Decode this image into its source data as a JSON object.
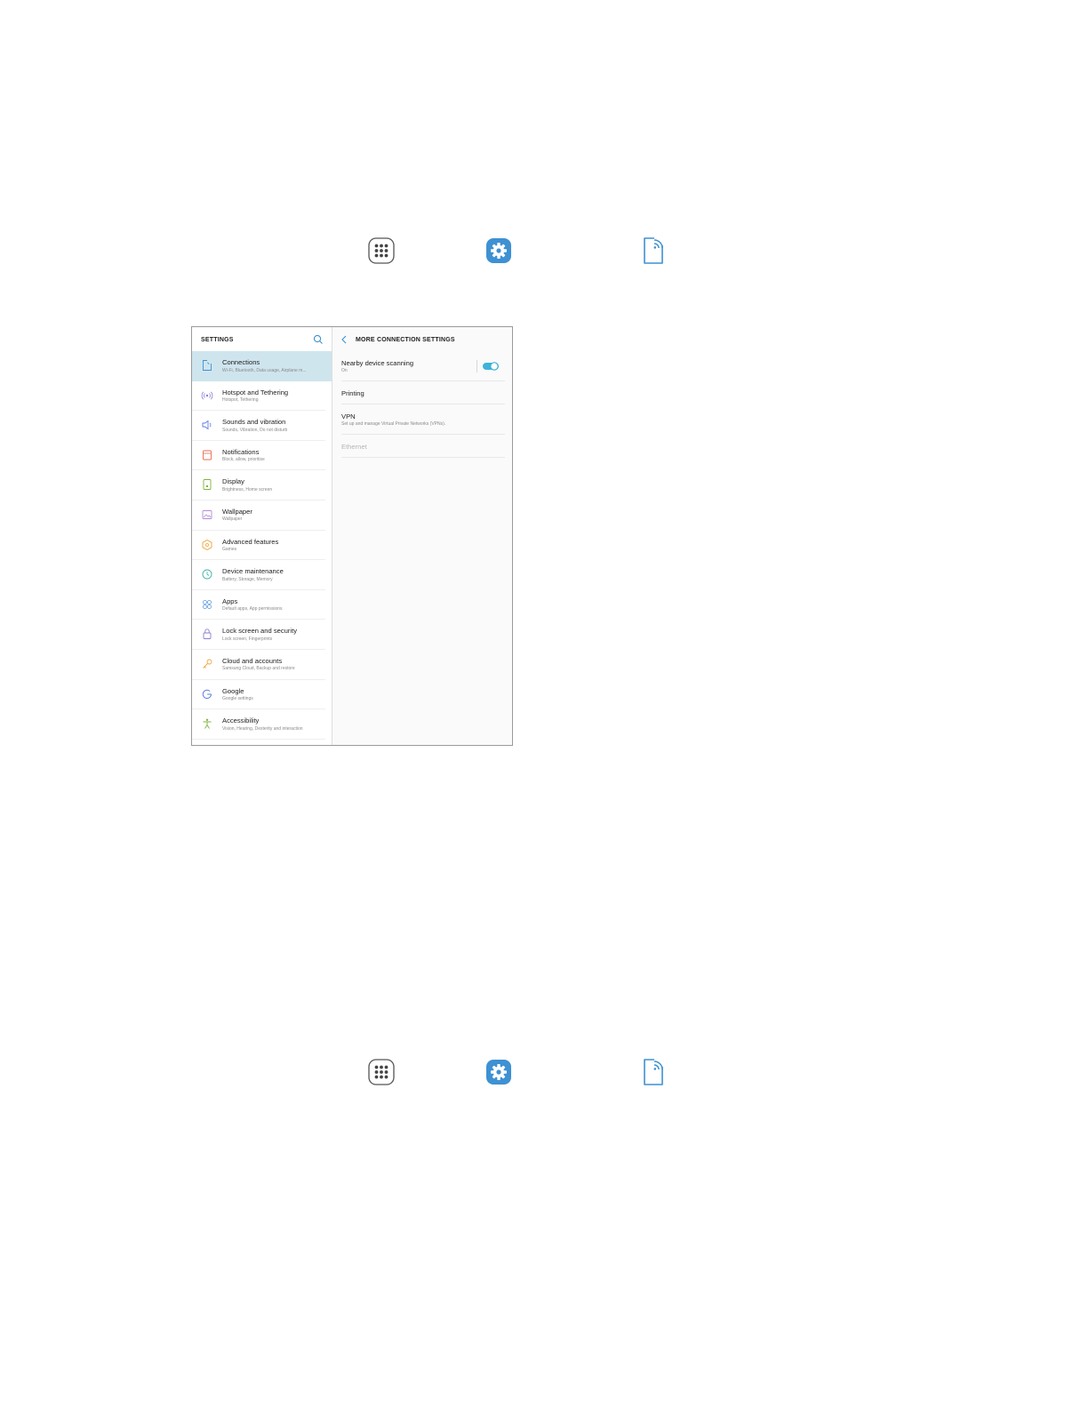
{
  "icons": {
    "apps_icon": "apps-grid-icon",
    "settings_icon": "settings-gear-icon",
    "connections_icon": "connections-icon"
  },
  "colors": {
    "accent": "#3e91d2",
    "selected_bg": "#cfe5ee",
    "toggle_on": "#3fb3d8"
  },
  "settings": {
    "header": "SETTINGS",
    "items": [
      {
        "title": "Connections",
        "subtitle": "Wi-Fi, Bluetooth, Data usage, Airplane m...",
        "icon": "connections-icon",
        "color": "#3e91d2",
        "selected": true
      },
      {
        "title": "Hotspot and Tethering",
        "subtitle": "Hotspot, Tethering",
        "icon": "hotspot-icon",
        "color": "#8e7bd8"
      },
      {
        "title": "Sounds and vibration",
        "subtitle": "Sounds, Vibration, Do not disturb",
        "icon": "sound-icon",
        "color": "#5b7ee0"
      },
      {
        "title": "Notifications",
        "subtitle": "Block, allow, prioritise",
        "icon": "notification-icon",
        "color": "#e86b50"
      },
      {
        "title": "Display",
        "subtitle": "Brightness, Home screen",
        "icon": "display-icon",
        "color": "#7fb33b"
      },
      {
        "title": "Wallpaper",
        "subtitle": "Wallpaper",
        "icon": "wallpaper-icon",
        "color": "#b48ad8"
      },
      {
        "title": "Advanced features",
        "subtitle": "Games",
        "icon": "advanced-features-icon",
        "color": "#f0a23a"
      },
      {
        "title": "Device maintenance",
        "subtitle": "Battery, Storage, Memory",
        "icon": "device-maintenance-icon",
        "color": "#3fb3a5"
      },
      {
        "title": "Apps",
        "subtitle": "Default apps, App permissions",
        "icon": "apps-icon",
        "color": "#5b98e0"
      },
      {
        "title": "Lock screen and security",
        "subtitle": "Lock screen, Fingerprints",
        "icon": "lock-icon",
        "color": "#8e7bd8"
      },
      {
        "title": "Cloud and accounts",
        "subtitle": "Samsung Cloud, Backup and restore",
        "icon": "key-icon",
        "color": "#f0a23a"
      },
      {
        "title": "Google",
        "subtitle": "Google settings",
        "icon": "google-icon",
        "color": "#5b7ee0"
      },
      {
        "title": "Accessibility",
        "subtitle": "Vision, Hearing, Dexterity and interaction",
        "icon": "accessibility-icon",
        "color": "#7fb33b"
      }
    ]
  },
  "more_connection": {
    "header": "MORE CONNECTION SETTINGS",
    "items": [
      {
        "title": "Nearby device scanning",
        "subtitle": "On",
        "toggle": true
      },
      {
        "title": "Printing",
        "subtitle": ""
      },
      {
        "title": "VPN",
        "subtitle": "Set up and manage Virtual Private Networks (VPNs)."
      },
      {
        "title": "Ethernet",
        "subtitle": "",
        "disabled": true
      }
    ]
  }
}
